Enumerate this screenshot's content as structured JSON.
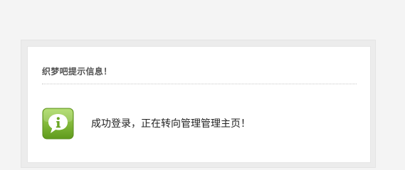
{
  "message_box": {
    "title": "织梦吧提示信息！",
    "body": "成功登录，正在转向管理管理主页！",
    "icon": "info-speech-bubble-icon",
    "colors": {
      "icon_green": "#7cb82f",
      "title_text": "#555555",
      "body_text": "#222222"
    }
  }
}
